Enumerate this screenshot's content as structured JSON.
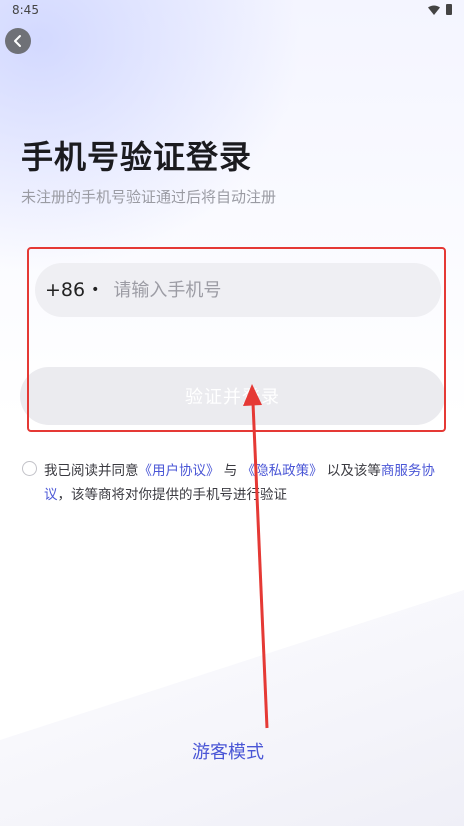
{
  "status_bar": {
    "time": "8:45",
    "wifi_icon": "wifi-icon",
    "battery_icon": "battery-icon"
  },
  "header": {
    "back_icon": "chevron-left-icon"
  },
  "page": {
    "title": "手机号验证登录",
    "subtitle": "未注册的手机号验证通过后将自动注册"
  },
  "phone": {
    "country_code": "+86",
    "separator": "•",
    "placeholder": "请输入手机号",
    "value": ""
  },
  "login_button": {
    "label": "验证并登录"
  },
  "agreement": {
    "checked": false,
    "part1": "我已阅读并同意",
    "user_agreement": "《用户协议》",
    "and": "与",
    "privacy_policy": "《隐私政策》",
    "part2": "以及该等",
    "merchant_agreement": "商服务协议",
    "part3": "，该等商将对你提供的手机号进行验证"
  },
  "guest": {
    "label": "游客模式"
  },
  "colors": {
    "accent": "#4a56d6",
    "annotation": "#e53935",
    "button_disabled": "#ebebef",
    "input_bg": "#efeff3"
  }
}
